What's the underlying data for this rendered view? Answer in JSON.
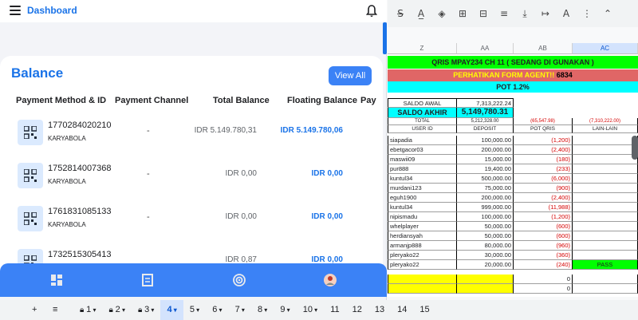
{
  "app": {
    "title": "Dashboard",
    "balance_title": "Balance",
    "view_all": "View All",
    "columns": [
      "Payment Method & ID",
      "Payment Channel",
      "Total Balance",
      "Floating Balance",
      "Pay"
    ],
    "rows": [
      {
        "id": "1770284020210",
        "name": "KARYABOLA",
        "channel": "-",
        "total": "IDR 5.149.780,31",
        "floating": "IDR 5.149.780,06"
      },
      {
        "id": "1752814007368",
        "name": "KARYABOLA",
        "channel": "-",
        "total": "IDR 0,00",
        "floating": "IDR 0,00"
      },
      {
        "id": "1761831085133",
        "name": "KARYABOLA",
        "channel": "-",
        "total": "IDR 0,00",
        "floating": "IDR 0,00"
      },
      {
        "id": "1732515305413",
        "name": "",
        "channel": "",
        "total": "IDR 0,87",
        "floating": "IDR 0,00"
      }
    ],
    "nav_icons": [
      "dashboard-icon",
      "report-icon",
      "radar-icon",
      "profile-icon"
    ]
  },
  "sheet": {
    "columns": [
      "Z",
      "AA",
      "AB",
      "AC"
    ],
    "banner_green": "QRIS MPAY234 CH 11  ( SEDANG DI GUNAKAN )",
    "banner_red": "PERHATIKAN FORM AGENT!!",
    "banner_red_value": "6834",
    "banner_cyan": "POT 1.2%",
    "saldo_awal_label": "SALDO AWAL",
    "saldo_awal": "7,313,222.24",
    "saldo_akhir_label": "SALDO AKHIR",
    "saldo_akhir": "5,149,780.31",
    "total_label": "TOTAL",
    "total_deposit": "5,212,328.00",
    "total_pot": "(65,547.98)",
    "total_lain": "(7,310,222.00)",
    "headers": [
      "USER ID",
      "DEPOSIT",
      "POT QRIS",
      "LAIN-LAIN"
    ],
    "rows": [
      [
        "siapadia",
        "100,000.00",
        "(1,200)",
        ""
      ],
      [
        "ebetgacor03",
        "200,000.00",
        "(2,400)",
        ""
      ],
      [
        "maswii09",
        "15,000.00",
        "(180)",
        ""
      ],
      [
        "pur888",
        "19,400.00",
        "(233)",
        ""
      ],
      [
        "kuntul34",
        "500,000.00",
        "(6,000)",
        ""
      ],
      [
        "murdani123",
        "75,000.00",
        "(900)",
        ""
      ],
      [
        "eguh1900",
        "200,000.00",
        "(2,400)",
        ""
      ],
      [
        "kuntul34",
        "999,000.00",
        "(11,988)",
        ""
      ],
      [
        "nipismadu",
        "100,000.00",
        "(1,200)",
        ""
      ],
      [
        "whelplayer",
        "50,000.00",
        "(600)",
        ""
      ],
      [
        "herdiansyah",
        "50,000.00",
        "(600)",
        ""
      ],
      [
        "armanjp888",
        "80,000.00",
        "(960)",
        ""
      ],
      [
        "pleryako22",
        "30,000.00",
        "(360)",
        ""
      ],
      [
        "pleryako22",
        "20,000.00",
        "(240)",
        "PASS"
      ]
    ],
    "zero1": "0",
    "zero2": "0",
    "tabs": [
      "1",
      "2",
      "3",
      "4",
      "5",
      "6",
      "7",
      "8",
      "9",
      "10",
      "11",
      "12",
      "13",
      "14",
      "15"
    ],
    "active_tab": "4",
    "colors": {
      "green": "#00ff00",
      "red": "#e06666",
      "cyan": "#00ffff",
      "yellow": "#ffff00",
      "blue": "#1a73e8"
    }
  }
}
